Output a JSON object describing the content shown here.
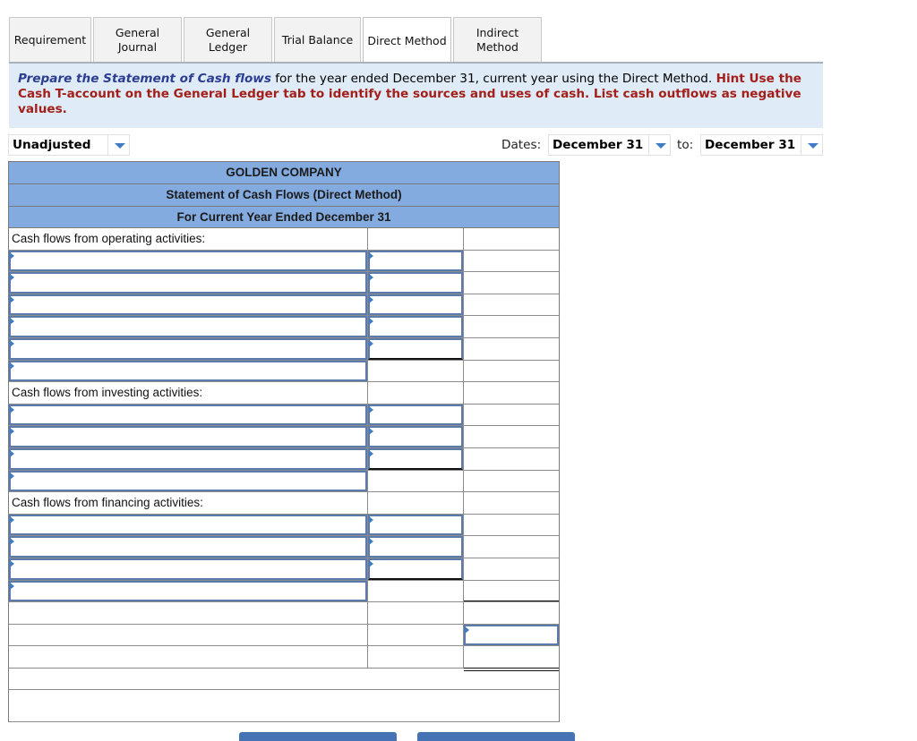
{
  "tabs": [
    {
      "label": "Requirement",
      "active": false
    },
    {
      "label": "General\nJournal",
      "active": false
    },
    {
      "label": "General\nLedger",
      "active": false
    },
    {
      "label": "Trial Balance",
      "active": false
    },
    {
      "label": "Direct Method",
      "active": true
    },
    {
      "label": "Indirect\nMethod",
      "active": false
    }
  ],
  "instructions": {
    "lead": "Prepare the Statement of Cash flows",
    "body": " for the year ended December 31, current year using the Direct Method.  ",
    "hint": "Hint  Use the Cash T-account on the General Ledger tab to identify the sources and uses of cash.  List cash outflows as negative values."
  },
  "controls": {
    "balance_type": "Unadjusted",
    "dates_label": "Dates:",
    "date_from": "December 31",
    "to_label": "to:",
    "date_to": "December 31"
  },
  "statement": {
    "company": "GOLDEN COMPANY",
    "title": "Statement of Cash Flows (Direct Method)",
    "period": "For Current Year Ended December 31",
    "sections": {
      "operating": "Cash flows from operating activities:",
      "investing": "Cash flows from investing activities:",
      "financing": "Cash flows from financing activities:"
    }
  },
  "buttons": {
    "prev": "",
    "next": ""
  }
}
